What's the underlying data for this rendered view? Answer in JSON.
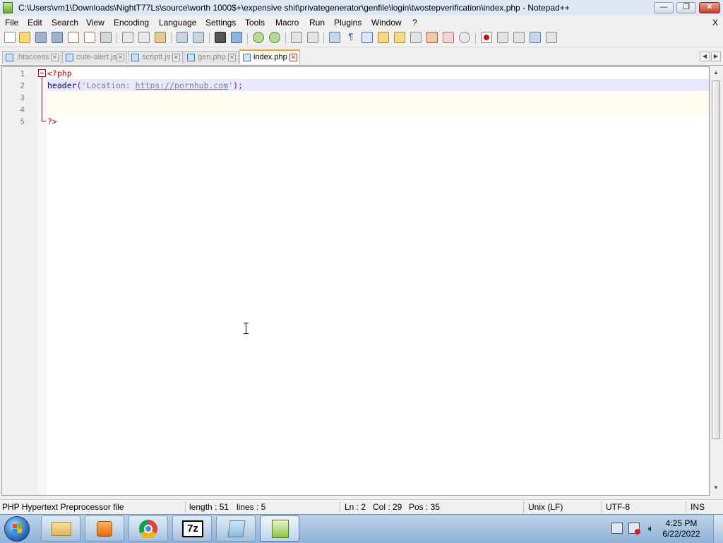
{
  "window": {
    "title": "C:\\Users\\vm1\\Downloads\\NightT77Ls\\source\\worth 1000$+\\expensive shit\\privategenerator\\genfile\\login\\twostepverification\\index.php - Notepad++",
    "minimize": "—",
    "restore": "❐",
    "close": "✕",
    "menu_close": "X"
  },
  "menu": [
    "File",
    "Edit",
    "Search",
    "View",
    "Encoding",
    "Language",
    "Settings",
    "Tools",
    "Macro",
    "Run",
    "Plugins",
    "Window",
    "?"
  ],
  "tabs": [
    {
      "label": ".htaccess",
      "active": false
    },
    {
      "label": "cute-alert.js",
      "active": false
    },
    {
      "label": "scriptt.js",
      "active": false
    },
    {
      "label": "gen.php",
      "active": false
    },
    {
      "label": "index.php",
      "active": true
    }
  ],
  "tab_close_glyph": "✕",
  "editor": {
    "line_numbers": [
      "1",
      "2",
      "3",
      "4",
      "5"
    ],
    "line1": "<?php",
    "line2": {
      "fn": "header",
      "open": "(",
      "str_start": "'Location: ",
      "url": "https://pornhub.com",
      "str_end": "'",
      "close": ");"
    },
    "line5": "?>"
  },
  "status": {
    "file_type": "PHP Hypertext Preprocessor file",
    "length": "length : 51",
    "lines": "lines : 5",
    "ln": "Ln : 2",
    "col": "Col : 29",
    "pos": "Pos : 35",
    "eol": "Unix (LF)",
    "encoding": "UTF-8",
    "mode": "INS"
  },
  "taskbar": {
    "time": "4:25 PM",
    "date": "6/22/2022",
    "sevenzip_label": "7z"
  },
  "colors": {
    "accent_tab": "#f4a32a",
    "current_line": "#e8e8ff",
    "php_tag": "#d00000",
    "function": "#000080"
  }
}
